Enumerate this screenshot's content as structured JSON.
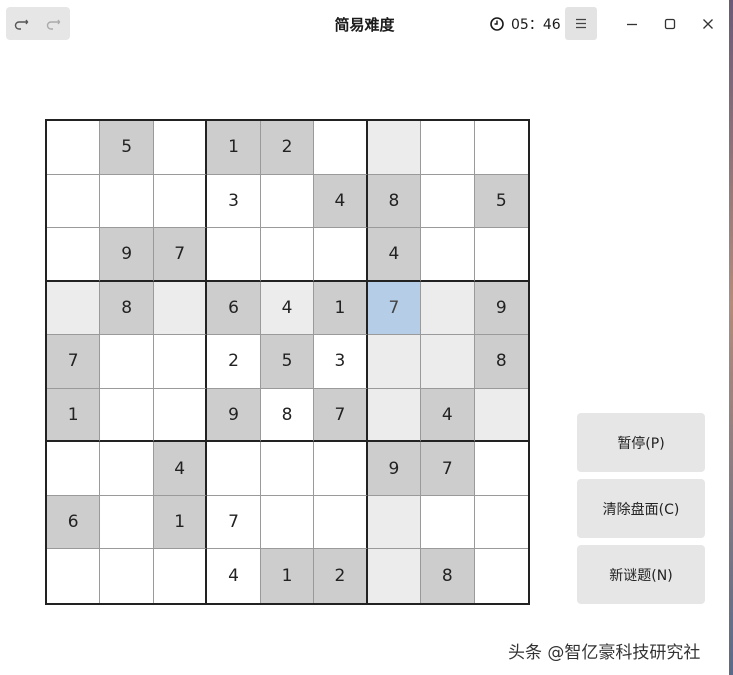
{
  "window": {
    "title": "简易难度",
    "timer": "05：46"
  },
  "actions": {
    "pause": "暂停(P)",
    "clear": "清除盘面(C)",
    "new_puzzle": "新谜题(N)"
  },
  "board": {
    "rows": [
      [
        {
          "v": "",
          "bg": "w"
        },
        {
          "v": "5",
          "bg": "g"
        },
        {
          "v": "",
          "bg": "w"
        },
        {
          "v": "1",
          "bg": "g"
        },
        {
          "v": "2",
          "bg": "g"
        },
        {
          "v": "",
          "bg": "w"
        },
        {
          "v": "",
          "bg": "l"
        },
        {
          "v": "",
          "bg": "w"
        },
        {
          "v": "",
          "bg": "w"
        }
      ],
      [
        {
          "v": "",
          "bg": "w"
        },
        {
          "v": "",
          "bg": "w"
        },
        {
          "v": "",
          "bg": "w"
        },
        {
          "v": "3",
          "bg": "w"
        },
        {
          "v": "",
          "bg": "w"
        },
        {
          "v": "4",
          "bg": "g"
        },
        {
          "v": "8",
          "bg": "g"
        },
        {
          "v": "",
          "bg": "w"
        },
        {
          "v": "5",
          "bg": "g"
        }
      ],
      [
        {
          "v": "",
          "bg": "w"
        },
        {
          "v": "9",
          "bg": "g"
        },
        {
          "v": "7",
          "bg": "g"
        },
        {
          "v": "",
          "bg": "w"
        },
        {
          "v": "",
          "bg": "w"
        },
        {
          "v": "",
          "bg": "w"
        },
        {
          "v": "4",
          "bg": "g"
        },
        {
          "v": "",
          "bg": "w"
        },
        {
          "v": "",
          "bg": "w"
        }
      ],
      [
        {
          "v": "",
          "bg": "l"
        },
        {
          "v": "8",
          "bg": "g"
        },
        {
          "v": "",
          "bg": "l"
        },
        {
          "v": "6",
          "bg": "g"
        },
        {
          "v": "4",
          "bg": "l"
        },
        {
          "v": "1",
          "bg": "g"
        },
        {
          "v": "7",
          "bg": "b"
        },
        {
          "v": "",
          "bg": "l"
        },
        {
          "v": "9",
          "bg": "g"
        }
      ],
      [
        {
          "v": "7",
          "bg": "g"
        },
        {
          "v": "",
          "bg": "w"
        },
        {
          "v": "",
          "bg": "w"
        },
        {
          "v": "2",
          "bg": "w"
        },
        {
          "v": "5",
          "bg": "g"
        },
        {
          "v": "3",
          "bg": "w"
        },
        {
          "v": "",
          "bg": "l"
        },
        {
          "v": "",
          "bg": "l"
        },
        {
          "v": "8",
          "bg": "g"
        }
      ],
      [
        {
          "v": "1",
          "bg": "g"
        },
        {
          "v": "",
          "bg": "w"
        },
        {
          "v": "",
          "bg": "w"
        },
        {
          "v": "9",
          "bg": "g"
        },
        {
          "v": "8",
          "bg": "w"
        },
        {
          "v": "7",
          "bg": "g"
        },
        {
          "v": "",
          "bg": "l"
        },
        {
          "v": "4",
          "bg": "g"
        },
        {
          "v": "",
          "bg": "l"
        }
      ],
      [
        {
          "v": "",
          "bg": "w"
        },
        {
          "v": "",
          "bg": "w"
        },
        {
          "v": "4",
          "bg": "g"
        },
        {
          "v": "",
          "bg": "w"
        },
        {
          "v": "",
          "bg": "w"
        },
        {
          "v": "",
          "bg": "w"
        },
        {
          "v": "9",
          "bg": "g"
        },
        {
          "v": "7",
          "bg": "g"
        },
        {
          "v": "",
          "bg": "w"
        }
      ],
      [
        {
          "v": "6",
          "bg": "g"
        },
        {
          "v": "",
          "bg": "w"
        },
        {
          "v": "1",
          "bg": "g"
        },
        {
          "v": "7",
          "bg": "w"
        },
        {
          "v": "",
          "bg": "w"
        },
        {
          "v": "",
          "bg": "w"
        },
        {
          "v": "",
          "bg": "l"
        },
        {
          "v": "",
          "bg": "w"
        },
        {
          "v": "",
          "bg": "w"
        }
      ],
      [
        {
          "v": "",
          "bg": "w"
        },
        {
          "v": "",
          "bg": "w"
        },
        {
          "v": "",
          "bg": "w"
        },
        {
          "v": "4",
          "bg": "w"
        },
        {
          "v": "1",
          "bg": "g"
        },
        {
          "v": "2",
          "bg": "g"
        },
        {
          "v": "",
          "bg": "l"
        },
        {
          "v": "8",
          "bg": "g"
        },
        {
          "v": "",
          "bg": "w"
        }
      ]
    ]
  },
  "watermark": "头条 @智亿豪科技研究社",
  "icons": {
    "undo": "undo-icon",
    "redo": "redo-icon",
    "timer": "clock-icon",
    "menu": "hamburger-menu-icon",
    "minimize": "minimize-icon",
    "maximize": "maximize-icon",
    "close": "close-icon"
  },
  "colors": {
    "given_cell": "#cdcdcd",
    "highlight_cell": "#ececec",
    "selected_cell": "#b5cde6"
  }
}
